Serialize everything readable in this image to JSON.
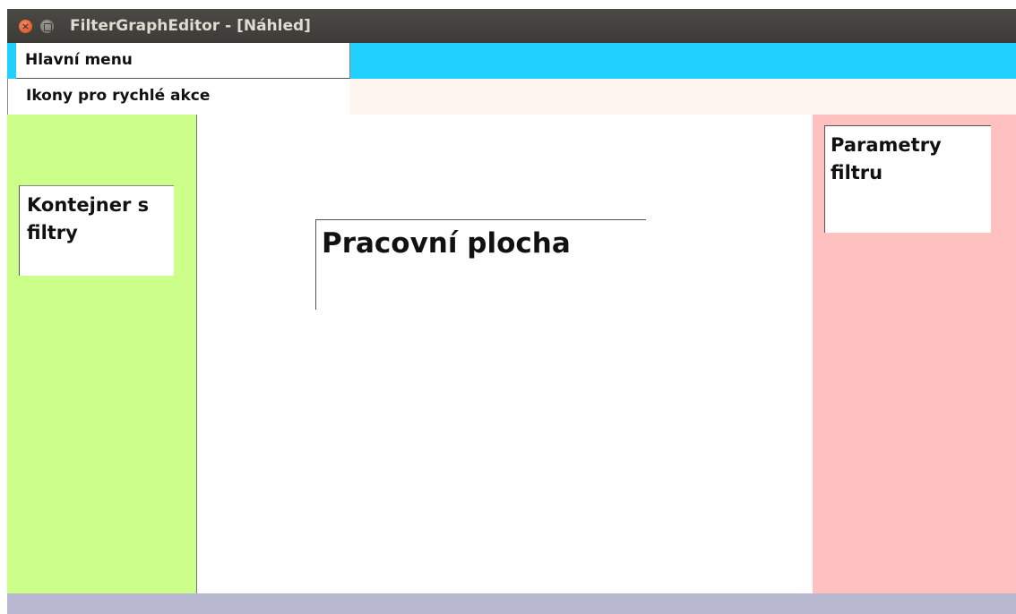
{
  "window": {
    "title": "FilterGraphEditor - [Náhled]",
    "close_glyph": "×"
  },
  "menu_bar": {
    "label": "Hlavní menu",
    "background": "#21d0ff"
  },
  "quick_actions": {
    "label": "Ikony pro rychlé akce",
    "background": "#fdf5ee"
  },
  "left_panel": {
    "label": "Kontejner s filtry",
    "background": "#ccff8a"
  },
  "workspace": {
    "label": "Pracovní plocha",
    "background": "#ffffff"
  },
  "right_panel": {
    "label": "Parametry filtru",
    "background": "#ffc0c0"
  },
  "status_bar": {
    "background": "#b7b8cf"
  }
}
